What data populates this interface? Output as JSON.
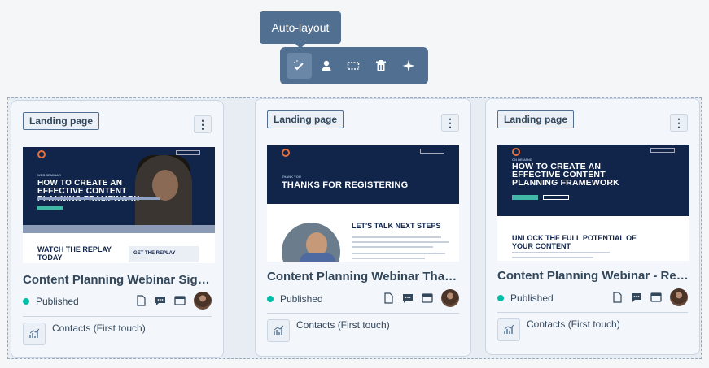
{
  "tooltip": "Auto-layout",
  "toolbar": {
    "buttons": [
      "auto-layout-icon",
      "person-icon",
      "marquee-select-icon",
      "trash-icon",
      "sparkle-icon"
    ]
  },
  "cards": [
    {
      "tag": "Landing page",
      "menu": "⋮",
      "title": "Content Planning Webinar Sign ...",
      "status": "Published",
      "contacts": "Contacts (First touch)",
      "thumb": {
        "eyebrow": "WEB SEMINAR",
        "headline": "HOW TO CREATE AN EFFECTIVE CONTENT PLANNING FRAMEWORK",
        "body_left": "WATCH THE REPLAY TODAY",
        "body_box": "GET THE REPLAY"
      }
    },
    {
      "tag": "Landing page",
      "menu": "⋮",
      "title": "Content Planning Webinar Than...",
      "status": "Published",
      "contacts": "Contacts (First touch)",
      "thumb": {
        "eyebrow": "THANK YOU",
        "headline": "THANKS FOR REGISTERING",
        "body_right": "LET'S TALK NEXT STEPS"
      }
    },
    {
      "tag": "Landing page",
      "menu": "⋮",
      "title": "Content Planning Webinar - Rep...",
      "status": "Published",
      "contacts": "Contacts (First touch)",
      "thumb": {
        "eyebrow": "ON DEMAND",
        "headline": "HOW TO CREATE AN EFFECTIVE CONTENT PLANNING FRAMEWORK",
        "body_left": "UNLOCK THE FULL POTENTIAL OF YOUR CONTENT"
      }
    }
  ],
  "colors": {
    "toolbar": "#516f90",
    "published": "#00bda5",
    "hero": "#11254b",
    "accent": "#e66e3d"
  }
}
